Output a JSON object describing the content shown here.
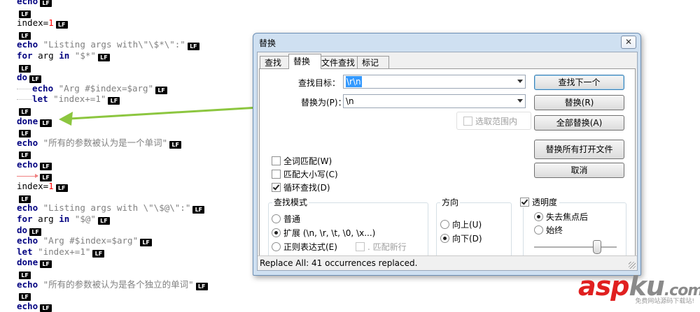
{
  "editor": {
    "lines": [
      {
        "text": "echo",
        "kind": "kw"
      },
      {
        "text": "",
        "kind": "empty"
      },
      {
        "pre": "index=",
        "num": "1"
      },
      {
        "text": "",
        "kind": "empty"
      },
      {
        "kw": "echo ",
        "str": "\"Listing args with\\\"\\$*\\\":\""
      },
      {
        "kw": "for ",
        "plain": "arg ",
        "kw2": "in ",
        "str": "\"$*\""
      },
      {
        "text": "",
        "kind": "empty"
      },
      {
        "text": "do",
        "kind": "kw"
      },
      {
        "indent": true,
        "kw": "echo ",
        "str": "\"Arg #$index=$arg\""
      },
      {
        "indent": true,
        "kw": "let ",
        "str": "\"index+=1\""
      },
      {
        "text": "",
        "kind": "empty"
      },
      {
        "text": "done",
        "kind": "kw"
      },
      {
        "text": "",
        "kind": "empty"
      },
      {
        "kw": "echo ",
        "str": "\"所有的参数被认为是一个单词\""
      },
      {
        "text": "",
        "kind": "empty"
      },
      {
        "text": "echo",
        "kind": "kw"
      },
      {
        "tab": true
      },
      {
        "pre": "index=",
        "num": "1"
      },
      {
        "text": "",
        "kind": "empty"
      },
      {
        "kw": "echo ",
        "str": "\"Listing args with \\\"\\$@\\\":\""
      },
      {
        "kw": "for ",
        "plain": "arg ",
        "kw2": "in ",
        "str": "\"$@\""
      },
      {
        "text": "do",
        "kind": "kw"
      },
      {
        "kw": "echo ",
        "str": "\"Arg #$index=$arg\""
      },
      {
        "kw": "let ",
        "str": "\"index+=1\""
      },
      {
        "text": "done",
        "kind": "kw"
      },
      {
        "text": "",
        "kind": "empty"
      },
      {
        "kw": "echo ",
        "str": "\"所有的参数被认为是各个独立的单词\""
      },
      {
        "text": "",
        "kind": "empty"
      },
      {
        "text": "echo",
        "kind": "kw"
      }
    ],
    "eol_marker": "LF"
  },
  "dialog": {
    "title": "替换",
    "close_glyph": "✕",
    "tabs": [
      "查找",
      "替换",
      "文件查找",
      "标记"
    ],
    "active_tab": 1,
    "find_label": "查找目标：",
    "find_value": "\\r\\n",
    "replace_label": "替换为(P)：",
    "replace_value": "\\n",
    "in_selection_label": "选取范围内",
    "buttons": {
      "find_next": "查找下一个",
      "replace": "替换(R)",
      "replace_all": "全部替换(A)",
      "replace_all_open": "替换所有打开文件",
      "cancel": "取消"
    },
    "options": {
      "whole_word": "全词匹配(W)",
      "match_case": "匹配大小写(C)",
      "wrap_around": "循环查找(D)"
    },
    "search_mode": {
      "title": "查找模式",
      "normal": "普通",
      "extended": "扩展 (\\n, \\r, \\t, \\0, \\x...)",
      "regex": "正则表达式(E)",
      "dot_newline": ". 匹配新行"
    },
    "direction": {
      "title": "方向",
      "up": "向上(U)",
      "down": "向下(D)"
    },
    "transparency": {
      "title": "透明度",
      "on_lose_focus": "失去焦点后",
      "always": "始终"
    },
    "status": "Replace All: 41 occurrences replaced."
  },
  "watermark": {
    "main_red": "asp",
    "main_gray": "ku",
    "main_tld": ".com",
    "sub": "免费网站源码下载站!"
  },
  "colors": {
    "arrow": "#8cc63f",
    "dialog_frame": "#cfe0f1",
    "selection": "#3399ff"
  }
}
